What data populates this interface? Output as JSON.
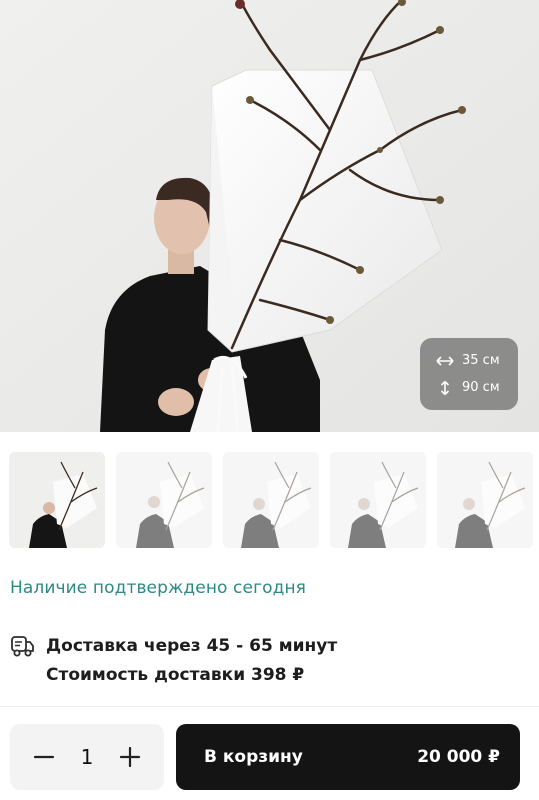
{
  "product": {
    "image_icon": "magnolia-bouquet-photo",
    "dimensions": {
      "width_label": "35 см",
      "height_label": "90 см"
    },
    "thumbnails_count": 5
  },
  "availability": {
    "text": "Наличие подтверждено сегодня",
    "color": "#2b8a84"
  },
  "delivery": {
    "icon": "delivery-truck-icon",
    "time_text": "Доставка через 45 - 65 минут",
    "cost_text": "Стоимость доставки 398 ₽"
  },
  "purchase": {
    "quantity": "1",
    "cart_label": "В корзину",
    "price": "20 000 ₽"
  }
}
